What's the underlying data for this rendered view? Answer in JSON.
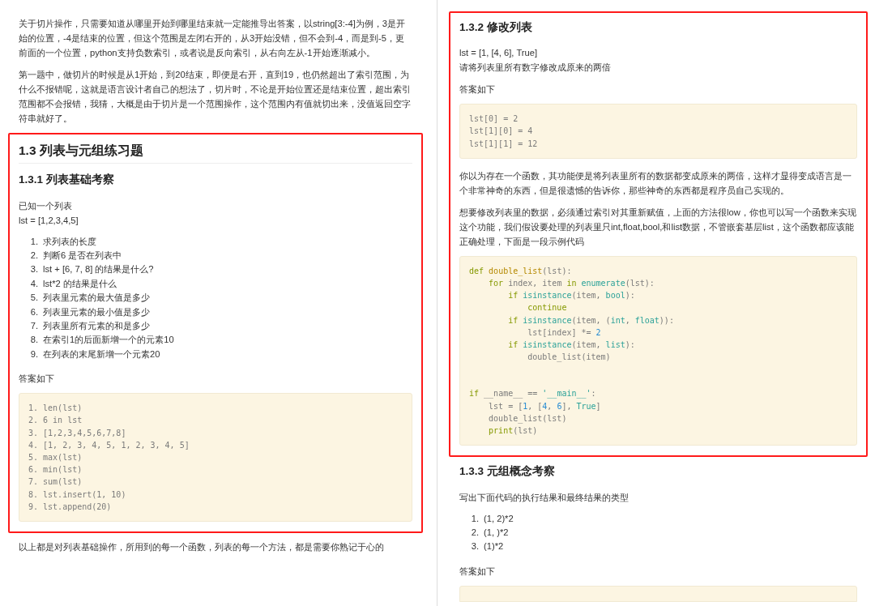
{
  "columns": [
    {
      "blocks": [
        {
          "kind": "p",
          "lines": [
            "关于切片操作，只需要知道从哪里开始到哪里结束就一定能推导出答案，以string[3:-4]为例，3是开始的位置，-4是结束的位置，但这个范围是左闭右开的，从3开始没错，但不会到-4，而是到-5，更前面的一个位置，python支持负数索引，或者说是反向索引，从右向左从-1开始逐渐减小。"
          ]
        },
        {
          "kind": "p",
          "lines": [
            "第一题中，做切片的时候是从1开始，到20结束，即便是右开，直到19，也仍然超出了索引范围，为什么不报错呢，这就是语言设计者自己的想法了，切片时，不论是开始位置还是结束位置，超出索引范围都不会报错，我猜，大概是由于切片是一个范围操作，这个范围内有值就切出来，没值返回空字符串就好了。"
          ]
        },
        {
          "kind": "frame",
          "highlighted": true,
          "blocks": [
            {
              "kind": "h2",
              "text": "1.3 列表与元组练习题"
            },
            {
              "kind": "h3",
              "text": "1.3.1 列表基础考察"
            },
            {
              "kind": "p",
              "lines": [
                "已知一个列表",
                "lst = [1,2,3,4,5]"
              ]
            },
            {
              "kind": "ol",
              "items": [
                {
                  "number": "1.",
                  "text": "求列表的长度"
                },
                {
                  "number": "2.",
                  "text": "判断6 是否在列表中"
                },
                {
                  "number": "3.",
                  "text": "lst + [6, 7, 8] 的结果是什么?"
                },
                {
                  "number": "4.",
                  "text": "lst*2 的结果是什么"
                },
                {
                  "number": "5.",
                  "text": "列表里元素的最大值是多少"
                },
                {
                  "number": "6.",
                  "text": "列表里元素的最小值是多少"
                },
                {
                  "number": "7.",
                  "text": "列表里所有元素的和是多少"
                },
                {
                  "number": "8.",
                  "text": "在索引1的后面新增一个的元素10"
                },
                {
                  "number": "9.",
                  "text": "在列表的末尾新增一个元素20"
                }
              ]
            },
            {
              "kind": "p",
              "lines": [
                "答案如下"
              ]
            },
            {
              "kind": "code",
              "lines": [
                {
                  "tokens": [
                    {
                      "t": "1. len(lst)"
                    }
                  ]
                },
                {
                  "tokens": [
                    {
                      "t": "2. 6 in lst"
                    }
                  ]
                },
                {
                  "tokens": [
                    {
                      "t": "3. [1,2,3,4,5,6,7,8]"
                    }
                  ]
                },
                {
                  "tokens": [
                    {
                      "t": "4. [1, 2, 3, 4, 5, 1, 2, 3, 4, 5]"
                    }
                  ]
                },
                {
                  "tokens": [
                    {
                      "t": "5. max(lst)"
                    }
                  ]
                },
                {
                  "tokens": [
                    {
                      "t": "6. min(lst)"
                    }
                  ]
                },
                {
                  "tokens": [
                    {
                      "t": "7. sum(lst)"
                    }
                  ]
                },
                {
                  "tokens": [
                    {
                      "t": "8. lst.insert(1, 10)"
                    }
                  ]
                },
                {
                  "tokens": [
                    {
                      "t": "9. lst.append(20)"
                    }
                  ]
                }
              ]
            }
          ]
        },
        {
          "kind": "p",
          "lines": [
            "以上都是对列表基础操作，所用到的每一个函数，列表的每一个方法，都是需要你熟记于心的"
          ]
        }
      ]
    },
    {
      "blocks": [
        {
          "kind": "frame",
          "highlighted": true,
          "blocks": [
            {
              "kind": "h3",
              "text": "1.3.2 修改列表"
            },
            {
              "kind": "p",
              "lines": [
                "lst = [1, [4, 6], True]",
                "请将列表里所有数字修改成原来的两倍"
              ]
            },
            {
              "kind": "p",
              "lines": [
                "答案如下"
              ]
            },
            {
              "kind": "code",
              "lines": [
                {
                  "tokens": [
                    {
                      "t": "lst[0] = 2"
                    }
                  ]
                },
                {
                  "tokens": [
                    {
                      "t": "lst[1][0] = 4"
                    }
                  ]
                },
                {
                  "tokens": [
                    {
                      "t": "lst[1][1] = 12"
                    }
                  ]
                }
              ]
            },
            {
              "kind": "p",
              "lines": [
                "你以为存在一个函数，其功能便是将列表里所有的数据都变成原来的两倍，这样才显得变成语言是一个非常神奇的东西，但是很遗憾的告诉你，那些神奇的东西都是程序员自己实现的。"
              ]
            },
            {
              "kind": "p",
              "lines": [
                "想要修改列表里的数据，必须通过索引对其重新赋值，上面的方法很low，你也可以写一个函数来实现这个功能，我们假设要处理的列表里只int,float,bool,和list数据，不管嵌套基层list，这个函数都应该能正确处理，下面是一段示例代码"
              ]
            },
            {
              "kind": "code",
              "lines": [
                {
                  "tokens": [
                    {
                      "t": "def ",
                      "kind": "keyword"
                    },
                    {
                      "t": "double_list",
                      "kind": "function"
                    },
                    {
                      "t": "(lst):"
                    }
                  ]
                },
                {
                  "tokens": [
                    {
                      "t": "    for",
                      "kind": "keyword"
                    },
                    {
                      "t": " index, item "
                    },
                    {
                      "t": "in ",
                      "kind": "keyword"
                    },
                    {
                      "t": "enumerate",
                      "kind": "builtin"
                    },
                    {
                      "t": "(lst):"
                    }
                  ]
                },
                {
                  "tokens": [
                    {
                      "t": "        if ",
                      "kind": "keyword"
                    },
                    {
                      "t": "isinstance",
                      "kind": "builtin"
                    },
                    {
                      "t": "(item, "
                    },
                    {
                      "t": "bool",
                      "kind": "builtin"
                    },
                    {
                      "t": "):"
                    }
                  ]
                },
                {
                  "tokens": [
                    {
                      "t": "            continue",
                      "kind": "keyword"
                    }
                  ]
                },
                {
                  "tokens": [
                    {
                      "t": "        if ",
                      "kind": "keyword"
                    },
                    {
                      "t": "isinstance",
                      "kind": "builtin"
                    },
                    {
                      "t": "(item, ("
                    },
                    {
                      "t": "int",
                      "kind": "builtin"
                    },
                    {
                      "t": ", "
                    },
                    {
                      "t": "float",
                      "kind": "builtin"
                    },
                    {
                      "t": ")):"
                    }
                  ]
                },
                {
                  "tokens": [
                    {
                      "t": "            lst[index] *= "
                    },
                    {
                      "t": "2",
                      "kind": "number"
                    }
                  ]
                },
                {
                  "tokens": [
                    {
                      "t": "        if ",
                      "kind": "keyword"
                    },
                    {
                      "t": "isinstance",
                      "kind": "builtin"
                    },
                    {
                      "t": "(item, "
                    },
                    {
                      "t": "list",
                      "kind": "builtin"
                    },
                    {
                      "t": "):"
                    }
                  ]
                },
                {
                  "tokens": [
                    {
                      "t": "            double_list(item)"
                    }
                  ]
                },
                {
                  "spaced": true,
                  "tokens": [
                    {
                      "t": "if",
                      "kind": "keyword"
                    },
                    {
                      "t": " __name__ == "
                    },
                    {
                      "t": "'__main__'",
                      "kind": "string"
                    },
                    {
                      "t": ":"
                    }
                  ]
                },
                {
                  "tokens": [
                    {
                      "t": "    lst = ["
                    },
                    {
                      "t": "1",
                      "kind": "number"
                    },
                    {
                      "t": ", ["
                    },
                    {
                      "t": "4",
                      "kind": "number"
                    },
                    {
                      "t": ", "
                    },
                    {
                      "t": "6",
                      "kind": "number"
                    },
                    {
                      "t": "], "
                    },
                    {
                      "t": "True",
                      "kind": "builtin"
                    },
                    {
                      "t": "]"
                    }
                  ]
                },
                {
                  "tokens": [
                    {
                      "t": "    double_list(lst)"
                    }
                  ]
                },
                {
                  "tokens": [
                    {
                      "t": "    print",
                      "kind": "keyword"
                    },
                    {
                      "t": "(lst)"
                    }
                  ]
                }
              ]
            }
          ]
        },
        {
          "kind": "h3",
          "text": "1.3.3 元组概念考察"
        },
        {
          "kind": "p",
          "lines": [
            "写出下面代码的执行结果和最终结果的类型"
          ]
        },
        {
          "kind": "ol",
          "items": [
            {
              "number": "1.",
              "text": "(1, 2)*2"
            },
            {
              "number": "2.",
              "text": "(1, )*2"
            },
            {
              "number": "3.",
              "text": "(1)*2"
            }
          ]
        },
        {
          "kind": "p",
          "lines": [
            "答案如下"
          ]
        },
        {
          "kind": "code_cut"
        }
      ]
    }
  ]
}
